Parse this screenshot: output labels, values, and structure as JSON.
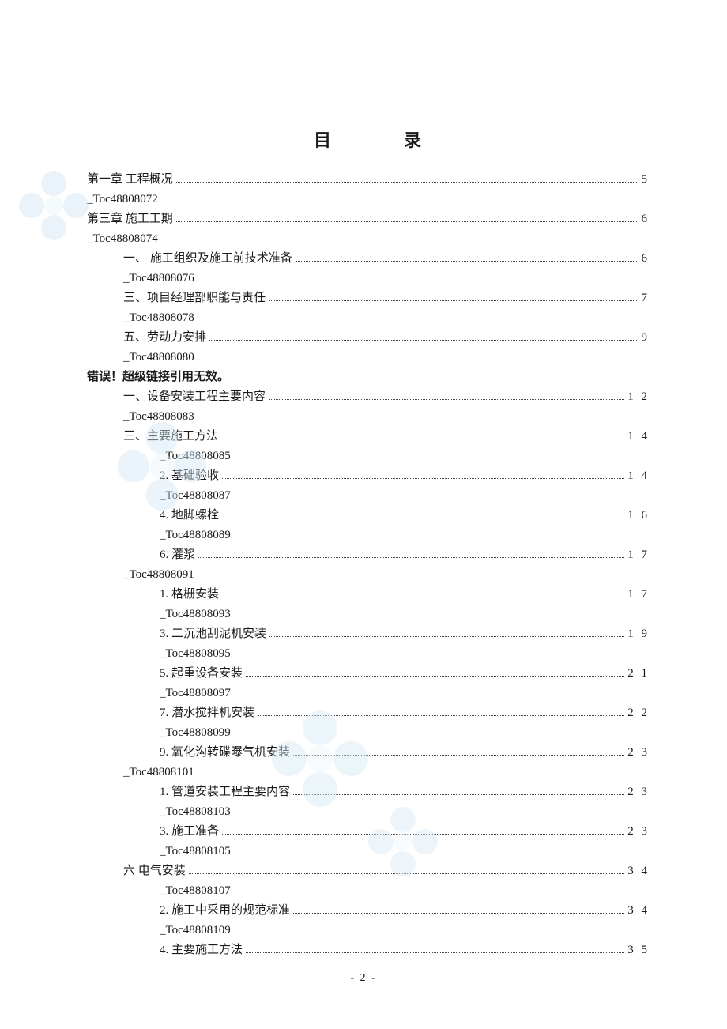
{
  "title_left": "目",
  "title_right": "录",
  "error_text": "错误！超级链接引用无效。",
  "page_number": "- 2 -",
  "toc": [
    {
      "level": 0,
      "label": "第一章 工程概况",
      "page": "5"
    },
    {
      "level": 0,
      "plain": true,
      "label": "_Toc48808072"
    },
    {
      "level": 0,
      "label": "第三章 施工工期",
      "page": "6"
    },
    {
      "level": 0,
      "plain": true,
      "label": "_Toc48808074"
    },
    {
      "level": 1,
      "label": "一、 施工组织及施工前技术准备",
      "page": "6"
    },
    {
      "level": 1,
      "plain": true,
      "label": "_Toc48808076"
    },
    {
      "level": 1,
      "label": "三、项目经理部职能与责任",
      "page": "7"
    },
    {
      "level": 1,
      "plain": true,
      "label": "_Toc48808078"
    },
    {
      "level": 1,
      "label": "五、劳动力安排",
      "page": "9"
    },
    {
      "level": 1,
      "plain": true,
      "label": "_Toc48808080"
    },
    {
      "level": 0,
      "error": true
    },
    {
      "level": 1,
      "label": "一、设备安装工程主要内容",
      "page": "1 2"
    },
    {
      "level": 1,
      "plain": true,
      "label": "_Toc48808083"
    },
    {
      "level": 1,
      "label": "三、主要施工方法",
      "page": "1 4"
    },
    {
      "level": 2,
      "plain": true,
      "label": "_Toc48808085"
    },
    {
      "level": 2,
      "label": "2. 基础验收",
      "page": "1 4"
    },
    {
      "level": 2,
      "plain": true,
      "label": "_Toc48808087"
    },
    {
      "level": 2,
      "label": "4. 地脚螺栓",
      "page": "1 6"
    },
    {
      "level": 2,
      "plain": true,
      "label": "_Toc48808089"
    },
    {
      "level": 2,
      "label": "6. 灌浆",
      "page": "1 7"
    },
    {
      "level": 1,
      "plain": true,
      "label": "_Toc48808091"
    },
    {
      "level": 2,
      "label": "1. 格栅安装",
      "page": "1 7"
    },
    {
      "level": 2,
      "plain": true,
      "label": "_Toc48808093"
    },
    {
      "level": 2,
      "label": "3. 二沉池刮泥机安装",
      "page": "1 9"
    },
    {
      "level": 2,
      "plain": true,
      "label": "_Toc48808095"
    },
    {
      "level": 2,
      "label": "5. 起重设备安装",
      "page": "2 1"
    },
    {
      "level": 2,
      "plain": true,
      "label": "_Toc48808097"
    },
    {
      "level": 2,
      "label": "7. 潜水搅拌机安装",
      "page": "2 2"
    },
    {
      "level": 2,
      "plain": true,
      "label": "_Toc48808099"
    },
    {
      "level": 2,
      "label": "9. 氧化沟转碟曝气机安装",
      "page": "2 3"
    },
    {
      "level": 1,
      "plain": true,
      "label": "_Toc48808101"
    },
    {
      "level": 2,
      "label": "1. 管道安装工程主要内容",
      "page": "2 3"
    },
    {
      "level": 2,
      "plain": true,
      "label": "_Toc48808103"
    },
    {
      "level": 2,
      "label": "3. 施工准备",
      "page": "2 3"
    },
    {
      "level": 2,
      "plain": true,
      "label": "_Toc48808105"
    },
    {
      "level": 1,
      "label": "六 电气安装",
      "page": "3 4"
    },
    {
      "level": 2,
      "plain": true,
      "label": "_Toc48808107"
    },
    {
      "level": 2,
      "label": "2. 施工中采用的规范标准",
      "page": "3 4"
    },
    {
      "level": 2,
      "plain": true,
      "label": "_Toc48808109"
    },
    {
      "level": 2,
      "label": "4. 主要施工方法",
      "page": "3 5"
    }
  ]
}
